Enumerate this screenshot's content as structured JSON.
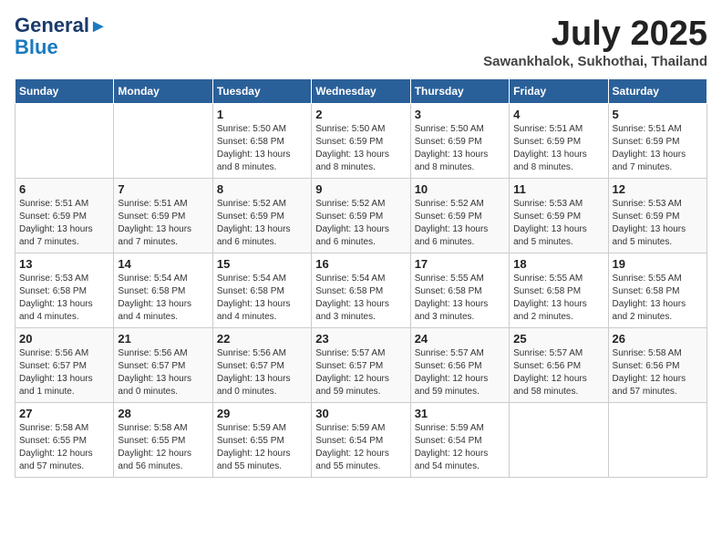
{
  "logo": {
    "line1": "General",
    "line2": "Blue"
  },
  "header": {
    "month": "July 2025",
    "location": "Sawankhalok, Sukhothai, Thailand"
  },
  "weekdays": [
    "Sunday",
    "Monday",
    "Tuesday",
    "Wednesday",
    "Thursday",
    "Friday",
    "Saturday"
  ],
  "weeks": [
    [
      {
        "day": "",
        "info": ""
      },
      {
        "day": "",
        "info": ""
      },
      {
        "day": "1",
        "info": "Sunrise: 5:50 AM\nSunset: 6:58 PM\nDaylight: 13 hours\nand 8 minutes."
      },
      {
        "day": "2",
        "info": "Sunrise: 5:50 AM\nSunset: 6:59 PM\nDaylight: 13 hours\nand 8 minutes."
      },
      {
        "day": "3",
        "info": "Sunrise: 5:50 AM\nSunset: 6:59 PM\nDaylight: 13 hours\nand 8 minutes."
      },
      {
        "day": "4",
        "info": "Sunrise: 5:51 AM\nSunset: 6:59 PM\nDaylight: 13 hours\nand 8 minutes."
      },
      {
        "day": "5",
        "info": "Sunrise: 5:51 AM\nSunset: 6:59 PM\nDaylight: 13 hours\nand 7 minutes."
      }
    ],
    [
      {
        "day": "6",
        "info": "Sunrise: 5:51 AM\nSunset: 6:59 PM\nDaylight: 13 hours\nand 7 minutes."
      },
      {
        "day": "7",
        "info": "Sunrise: 5:51 AM\nSunset: 6:59 PM\nDaylight: 13 hours\nand 7 minutes."
      },
      {
        "day": "8",
        "info": "Sunrise: 5:52 AM\nSunset: 6:59 PM\nDaylight: 13 hours\nand 6 minutes."
      },
      {
        "day": "9",
        "info": "Sunrise: 5:52 AM\nSunset: 6:59 PM\nDaylight: 13 hours\nand 6 minutes."
      },
      {
        "day": "10",
        "info": "Sunrise: 5:52 AM\nSunset: 6:59 PM\nDaylight: 13 hours\nand 6 minutes."
      },
      {
        "day": "11",
        "info": "Sunrise: 5:53 AM\nSunset: 6:59 PM\nDaylight: 13 hours\nand 5 minutes."
      },
      {
        "day": "12",
        "info": "Sunrise: 5:53 AM\nSunset: 6:59 PM\nDaylight: 13 hours\nand 5 minutes."
      }
    ],
    [
      {
        "day": "13",
        "info": "Sunrise: 5:53 AM\nSunset: 6:58 PM\nDaylight: 13 hours\nand 4 minutes."
      },
      {
        "day": "14",
        "info": "Sunrise: 5:54 AM\nSunset: 6:58 PM\nDaylight: 13 hours\nand 4 minutes."
      },
      {
        "day": "15",
        "info": "Sunrise: 5:54 AM\nSunset: 6:58 PM\nDaylight: 13 hours\nand 4 minutes."
      },
      {
        "day": "16",
        "info": "Sunrise: 5:54 AM\nSunset: 6:58 PM\nDaylight: 13 hours\nand 3 minutes."
      },
      {
        "day": "17",
        "info": "Sunrise: 5:55 AM\nSunset: 6:58 PM\nDaylight: 13 hours\nand 3 minutes."
      },
      {
        "day": "18",
        "info": "Sunrise: 5:55 AM\nSunset: 6:58 PM\nDaylight: 13 hours\nand 2 minutes."
      },
      {
        "day": "19",
        "info": "Sunrise: 5:55 AM\nSunset: 6:58 PM\nDaylight: 13 hours\nand 2 minutes."
      }
    ],
    [
      {
        "day": "20",
        "info": "Sunrise: 5:56 AM\nSunset: 6:57 PM\nDaylight: 13 hours\nand 1 minute."
      },
      {
        "day": "21",
        "info": "Sunrise: 5:56 AM\nSunset: 6:57 PM\nDaylight: 13 hours\nand 0 minutes."
      },
      {
        "day": "22",
        "info": "Sunrise: 5:56 AM\nSunset: 6:57 PM\nDaylight: 13 hours\nand 0 minutes."
      },
      {
        "day": "23",
        "info": "Sunrise: 5:57 AM\nSunset: 6:57 PM\nDaylight: 12 hours\nand 59 minutes."
      },
      {
        "day": "24",
        "info": "Sunrise: 5:57 AM\nSunset: 6:56 PM\nDaylight: 12 hours\nand 59 minutes."
      },
      {
        "day": "25",
        "info": "Sunrise: 5:57 AM\nSunset: 6:56 PM\nDaylight: 12 hours\nand 58 minutes."
      },
      {
        "day": "26",
        "info": "Sunrise: 5:58 AM\nSunset: 6:56 PM\nDaylight: 12 hours\nand 57 minutes."
      }
    ],
    [
      {
        "day": "27",
        "info": "Sunrise: 5:58 AM\nSunset: 6:55 PM\nDaylight: 12 hours\nand 57 minutes."
      },
      {
        "day": "28",
        "info": "Sunrise: 5:58 AM\nSunset: 6:55 PM\nDaylight: 12 hours\nand 56 minutes."
      },
      {
        "day": "29",
        "info": "Sunrise: 5:59 AM\nSunset: 6:55 PM\nDaylight: 12 hours\nand 55 minutes."
      },
      {
        "day": "30",
        "info": "Sunrise: 5:59 AM\nSunset: 6:54 PM\nDaylight: 12 hours\nand 55 minutes."
      },
      {
        "day": "31",
        "info": "Sunrise: 5:59 AM\nSunset: 6:54 PM\nDaylight: 12 hours\nand 54 minutes."
      },
      {
        "day": "",
        "info": ""
      },
      {
        "day": "",
        "info": ""
      }
    ]
  ]
}
